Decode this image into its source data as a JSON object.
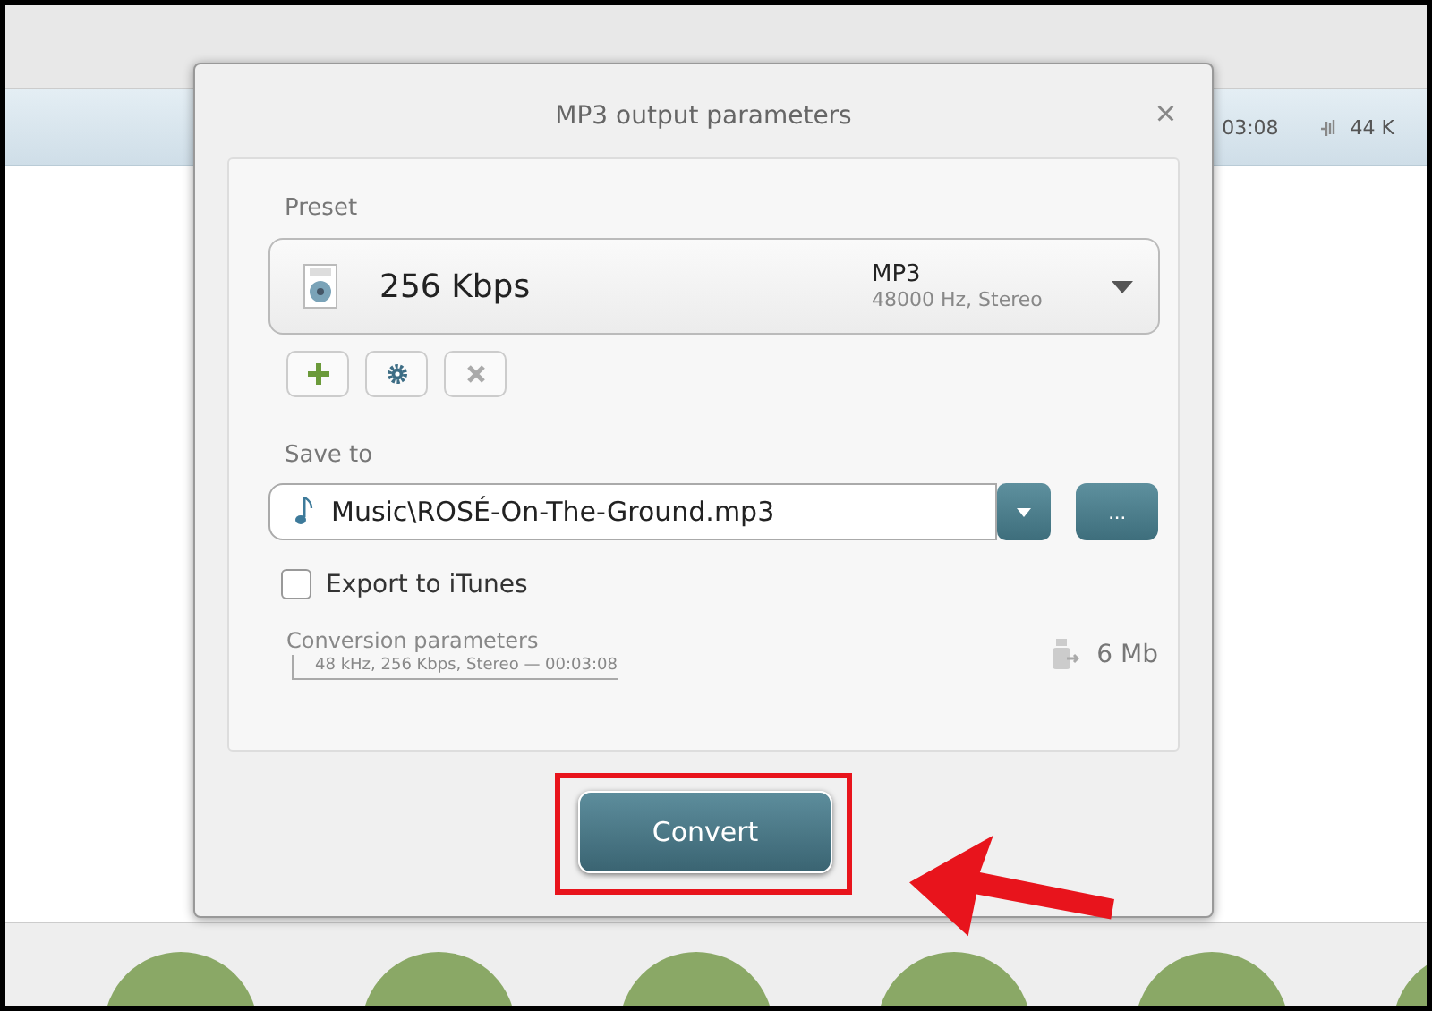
{
  "background": {
    "duration": "03:08",
    "bitrate": "44 K"
  },
  "dialog": {
    "title": "MP3 output parameters",
    "close": "×",
    "preset": {
      "label": "Preset",
      "name": "256 Kbps",
      "format": "MP3",
      "details": "48000 Hz,  Stereo"
    },
    "save_to": {
      "label": "Save to",
      "value": "Music\\ROSÉ-On-The-Ground.mp3",
      "browse": "..."
    },
    "export_itunes": {
      "label": "Export to iTunes",
      "checked": false
    },
    "conversion": {
      "label": "Conversion parameters",
      "summary": "48 kHz, 256 Kbps, Stereo — 00:03:08",
      "size": "6 Mb"
    },
    "convert_button": "Convert"
  }
}
